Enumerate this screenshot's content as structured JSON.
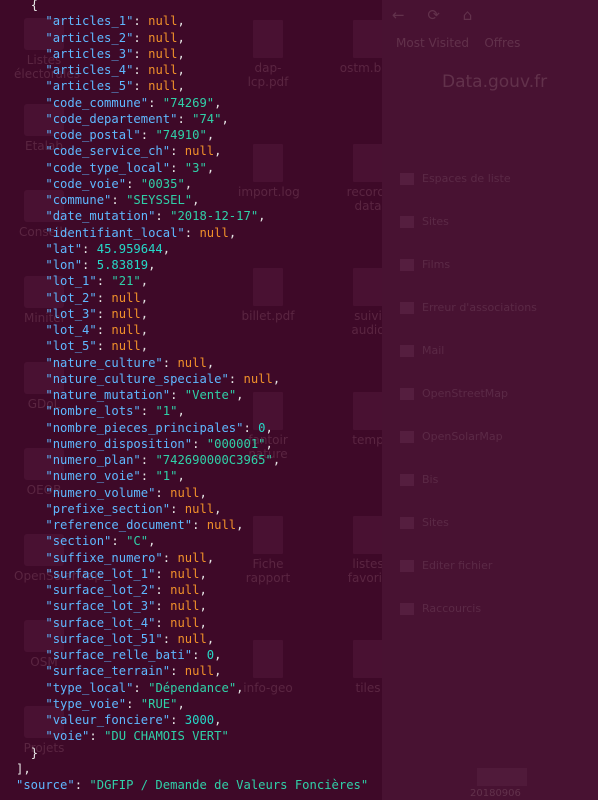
{
  "desktop": {
    "left_icons": [
      "Listes électorales",
      "Etalab",
      "Conseils",
      "Minitel",
      "GDoL",
      "OEOB",
      "OpenSolarMap",
      "OSM",
      "Projets"
    ],
    "middle_icons": [
      "dap-lcp.pdf",
      "ostm.ban",
      "import.log",
      "record-data",
      "billet.pdf",
      "suivi audio",
      "fantoir nature",
      "temp",
      "Fiche rapport",
      "listes favoris",
      "info-geo",
      "tiles"
    ]
  },
  "browser": {
    "nav": [
      "←",
      "⟳",
      "⌂"
    ],
    "bookmarks": [
      "Most Visited",
      "Offres"
    ],
    "page_title": "Data.gouv.fr",
    "items": [
      "Espaces de liste",
      "Sites",
      "Films",
      "Erreur d'associations",
      "Mail",
      "OpenStreetMap",
      "OpenSolarMap",
      "Bis",
      "Sites",
      "Editer fichier",
      "Raccourcis"
    ],
    "footer": "20180906"
  },
  "terminal": {
    "lines": [
      {
        "indent": "  ",
        "punct_open": "{"
      },
      {
        "indent": "    ",
        "key": "\"articles_1\"",
        "value": "null",
        "type": "null",
        "comma": ","
      },
      {
        "indent": "    ",
        "key": "\"articles_2\"",
        "value": "null",
        "type": "null",
        "comma": ","
      },
      {
        "indent": "    ",
        "key": "\"articles_3\"",
        "value": "null",
        "type": "null",
        "comma": ","
      },
      {
        "indent": "    ",
        "key": "\"articles_4\"",
        "value": "null",
        "type": "null",
        "comma": ","
      },
      {
        "indent": "    ",
        "key": "\"articles_5\"",
        "value": "null",
        "type": "null",
        "comma": ","
      },
      {
        "indent": "    ",
        "key": "\"code_commune\"",
        "value": "\"74269\"",
        "type": "string",
        "comma": ","
      },
      {
        "indent": "    ",
        "key": "\"code_departement\"",
        "value": "\"74\"",
        "type": "string",
        "comma": ","
      },
      {
        "indent": "    ",
        "key": "\"code_postal\"",
        "value": "\"74910\"",
        "type": "string",
        "comma": ","
      },
      {
        "indent": "    ",
        "key": "\"code_service_ch\"",
        "value": "null",
        "type": "null",
        "comma": ","
      },
      {
        "indent": "    ",
        "key": "\"code_type_local\"",
        "value": "\"3\"",
        "type": "string",
        "comma": ","
      },
      {
        "indent": "    ",
        "key": "\"code_voie\"",
        "value": "\"0035\"",
        "type": "string",
        "comma": ","
      },
      {
        "indent": "    ",
        "key": "\"commune\"",
        "value": "\"SEYSSEL\"",
        "type": "string",
        "comma": ","
      },
      {
        "indent": "    ",
        "key": "\"date_mutation\"",
        "value": "\"2018-12-17\"",
        "type": "string",
        "comma": ","
      },
      {
        "indent": "    ",
        "key": "\"identifiant_local\"",
        "value": "null",
        "type": "null",
        "comma": ","
      },
      {
        "indent": "    ",
        "key": "\"lat\"",
        "value": "45.959644",
        "type": "number",
        "comma": ","
      },
      {
        "indent": "    ",
        "key": "\"lon\"",
        "value": "5.83819",
        "type": "number",
        "comma": ","
      },
      {
        "indent": "    ",
        "key": "\"lot_1\"",
        "value": "\"21\"",
        "type": "string",
        "comma": ","
      },
      {
        "indent": "    ",
        "key": "\"lot_2\"",
        "value": "null",
        "type": "null",
        "comma": ","
      },
      {
        "indent": "    ",
        "key": "\"lot_3\"",
        "value": "null",
        "type": "null",
        "comma": ","
      },
      {
        "indent": "    ",
        "key": "\"lot_4\"",
        "value": "null",
        "type": "null",
        "comma": ","
      },
      {
        "indent": "    ",
        "key": "\"lot_5\"",
        "value": "null",
        "type": "null",
        "comma": ","
      },
      {
        "indent": "    ",
        "key": "\"nature_culture\"",
        "value": "null",
        "type": "null",
        "comma": ","
      },
      {
        "indent": "    ",
        "key": "\"nature_culture_speciale\"",
        "value": "null",
        "type": "null",
        "comma": ","
      },
      {
        "indent": "    ",
        "key": "\"nature_mutation\"",
        "value": "\"Vente\"",
        "type": "string",
        "comma": ","
      },
      {
        "indent": "    ",
        "key": "\"nombre_lots\"",
        "value": "\"1\"",
        "type": "string",
        "comma": ","
      },
      {
        "indent": "    ",
        "key": "\"nombre_pieces_principales\"",
        "value": "0",
        "type": "number",
        "comma": ","
      },
      {
        "indent": "    ",
        "key": "\"numero_disposition\"",
        "value": "\"000001\"",
        "type": "string",
        "comma": ","
      },
      {
        "indent": "    ",
        "key": "\"numero_plan\"",
        "value": "\"742690000C3965\"",
        "type": "string",
        "comma": ","
      },
      {
        "indent": "    ",
        "key": "\"numero_voie\"",
        "value": "\"1\"",
        "type": "string",
        "comma": ","
      },
      {
        "indent": "    ",
        "key": "\"numero_volume\"",
        "value": "null",
        "type": "null",
        "comma": ","
      },
      {
        "indent": "    ",
        "key": "\"prefixe_section\"",
        "value": "null",
        "type": "null",
        "comma": ","
      },
      {
        "indent": "    ",
        "key": "\"reference_document\"",
        "value": "null",
        "type": "null",
        "comma": ","
      },
      {
        "indent": "    ",
        "key": "\"section\"",
        "value": "\"C\"",
        "type": "string",
        "comma": ","
      },
      {
        "indent": "    ",
        "key": "\"suffixe_numero\"",
        "value": "null",
        "type": "null",
        "comma": ","
      },
      {
        "indent": "    ",
        "key": "\"surface_lot_1\"",
        "value": "null",
        "type": "null",
        "comma": ","
      },
      {
        "indent": "    ",
        "key": "\"surface_lot_2\"",
        "value": "null",
        "type": "null",
        "comma": ","
      },
      {
        "indent": "    ",
        "key": "\"surface_lot_3\"",
        "value": "null",
        "type": "null",
        "comma": ","
      },
      {
        "indent": "    ",
        "key": "\"surface_lot_4\"",
        "value": "null",
        "type": "null",
        "comma": ","
      },
      {
        "indent": "    ",
        "key": "\"surface_lot_51\"",
        "value": "null",
        "type": "null",
        "comma": ","
      },
      {
        "indent": "    ",
        "key": "\"surface_relle_bati\"",
        "value": "0",
        "type": "number",
        "comma": ","
      },
      {
        "indent": "    ",
        "key": "\"surface_terrain\"",
        "value": "null",
        "type": "null",
        "comma": ","
      },
      {
        "indent": "    ",
        "key": "\"type_local\"",
        "value": "\"Dépendance\"",
        "type": "string",
        "comma": ","
      },
      {
        "indent": "    ",
        "key": "\"type_voie\"",
        "value": "\"RUE\"",
        "type": "string",
        "comma": ","
      },
      {
        "indent": "    ",
        "key": "\"valeur_fonciere\"",
        "value": "3000",
        "type": "number",
        "comma": ","
      },
      {
        "indent": "    ",
        "key": "\"voie\"",
        "value": "\"DU CHAMOIS VERT\"",
        "type": "string",
        "comma": ""
      },
      {
        "indent": "  ",
        "punct_open": "}"
      },
      {
        "indent": "",
        "punct_open": "],"
      },
      {
        "indent": "",
        "key": "\"source\"",
        "value": "\"DGFIP / Demande de Valeurs Foncières\"",
        "type": "string",
        "comma": ""
      }
    ]
  }
}
